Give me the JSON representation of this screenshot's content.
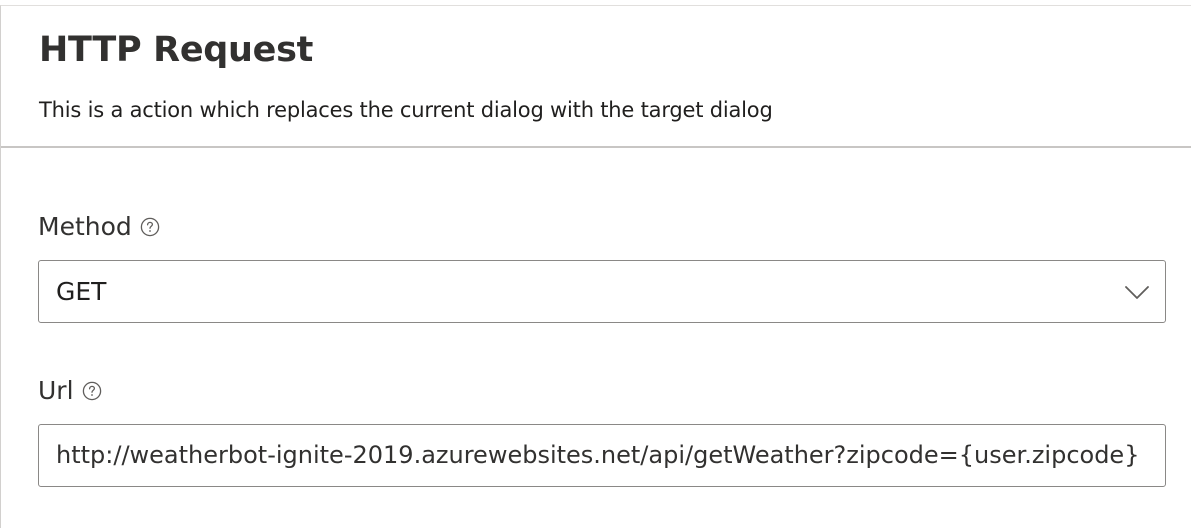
{
  "header": {
    "title": "HTTP Request",
    "description": "This is a action which replaces the current dialog with the target dialog"
  },
  "form": {
    "method": {
      "label": "Method",
      "value": "GET",
      "help_icon": "question-circle-icon",
      "dropdown_icon": "chevron-down-icon"
    },
    "url": {
      "label": "Url",
      "value": "http://weatherbot-ignite-2019.azurewebsites.net/api/getWeather?zipcode={user.zipcode}",
      "help_icon": "question-circle-icon"
    }
  },
  "colors": {
    "text": "#323130",
    "border": "#8a8886",
    "divider": "#c8c6c4",
    "background": "#ffffff"
  }
}
